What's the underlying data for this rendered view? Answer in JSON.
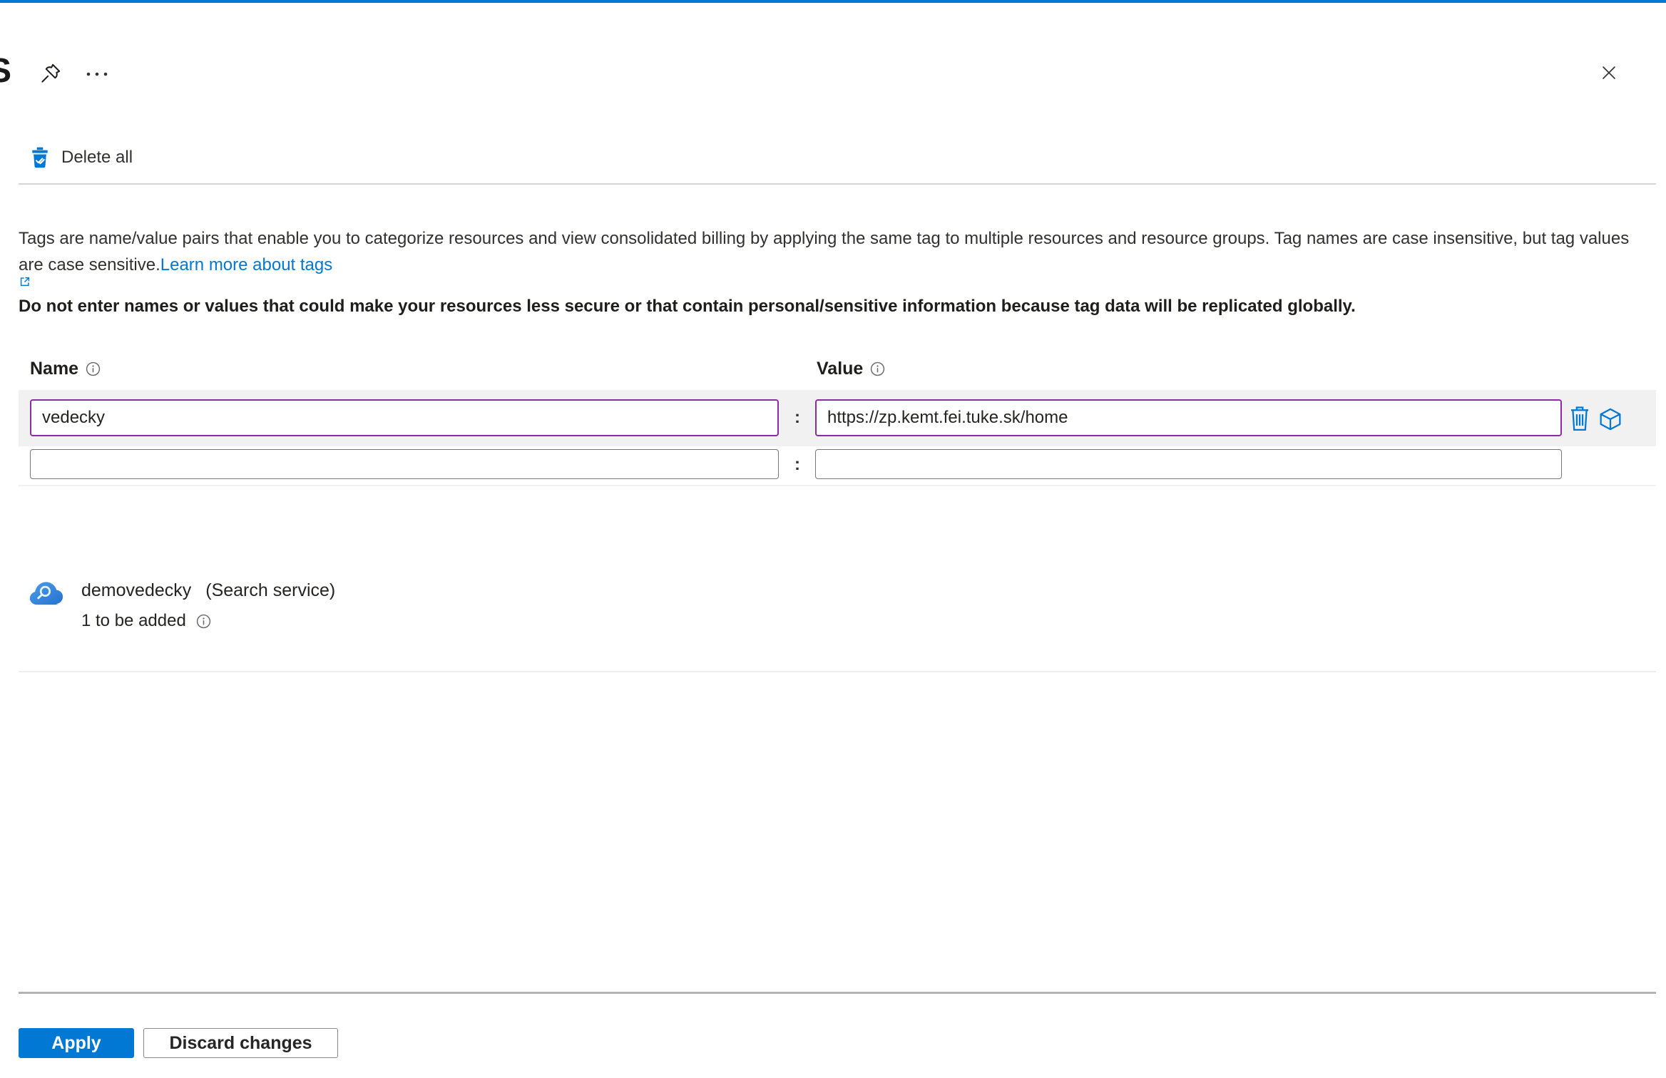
{
  "window": {
    "title_fragment": "S"
  },
  "colors": {
    "accent": "#0078d4",
    "modified_border": "#8a2da5",
    "link": "#0078d4"
  },
  "icons": {
    "pin": "pushpin-icon",
    "more": "ellipsis-icon",
    "close": "close-x-icon",
    "delete_all": "trash-with-check-icon",
    "info": "info-circle-icon",
    "external_link": "external-link-icon",
    "delete_row": "trash-outline-icon",
    "resource_cube": "cube-outline-icon",
    "search_service": "cloud-magnifier-icon"
  },
  "toolbar": {
    "delete_all_label": "Delete all"
  },
  "intro": {
    "description": "Tags are name/value pairs that enable you to categorize resources and view consolidated billing by applying the same tag to multiple resources and resource groups. Tag names are case insensitive, but tag values are case sensitive.",
    "learn_more_label": "Learn more about tags",
    "warning": "Do not enter names or values that could make your resources less secure or that contain personal/sensitive information because tag data will be replicated globally."
  },
  "table": {
    "name_header": "Name",
    "value_header": "Value",
    "separator": ":",
    "rows": [
      {
        "name": "vedecky",
        "value": "https://zp.kemt.fei.tuke.sk/home",
        "state": "modified"
      },
      {
        "name": "",
        "value": "",
        "state": "empty"
      }
    ]
  },
  "resource": {
    "name": "demovedecky",
    "type": "(Search service)",
    "pending_status": "1 to be added"
  },
  "actions": {
    "apply_label": "Apply",
    "discard_label": "Discard changes"
  }
}
